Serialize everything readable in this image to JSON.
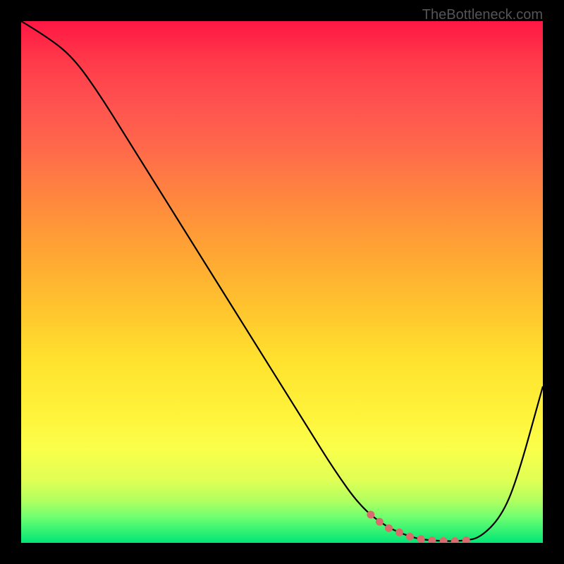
{
  "watermark": "TheBottleneck.com",
  "chart_data": {
    "type": "line",
    "title": "",
    "xlabel": "",
    "ylabel": "",
    "xlim": [
      0,
      100
    ],
    "ylim": [
      0,
      100
    ],
    "series": [
      {
        "name": "curve",
        "x": [
          0,
          5,
          10,
          15,
          20,
          25,
          30,
          35,
          40,
          45,
          50,
          55,
          60,
          65,
          70,
          75,
          78,
          82,
          85,
          88,
          92,
          95,
          100
        ],
        "y": [
          100,
          97,
          93,
          86,
          78,
          70,
          62,
          54,
          46,
          38,
          30,
          22,
          14,
          7,
          3,
          1,
          0.5,
          0.3,
          0.4,
          1,
          5,
          12,
          30
        ]
      }
    ],
    "highlight_region": {
      "x_start": 67,
      "x_end": 87,
      "color": "#e57373"
    },
    "background_gradient": {
      "top": "#ff1744",
      "middle": "#ffe22e",
      "bottom": "#00e676"
    }
  }
}
